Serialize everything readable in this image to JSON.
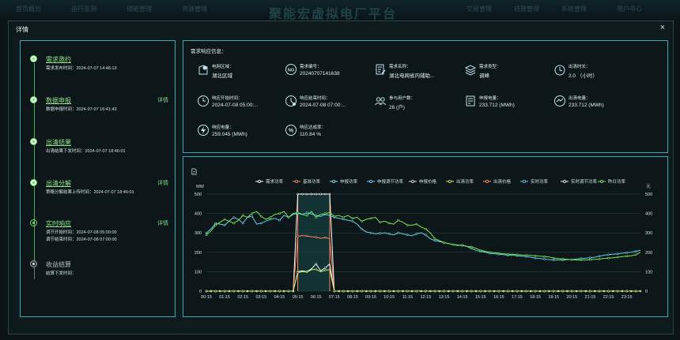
{
  "background": {
    "title": "聚能宏虚拟电厂平台",
    "nav_left": [
      "首页概览",
      "运行监测",
      "储能管理",
      "资源管理"
    ],
    "nav_right": [
      "交易管理",
      "结算管理",
      "系统管理",
      "用户中心"
    ]
  },
  "modal": {
    "title": "详情",
    "close_label": "×"
  },
  "timeline": [
    {
      "title": "需求邀约",
      "lines": [
        "需求发布时间：2024-07-07 14:46:13"
      ],
      "link": "",
      "state": "done"
    },
    {
      "title": "数据申报",
      "lines": [
        "数据申报时间：2024-07-07 16:41:43"
      ],
      "link": "详情",
      "state": "done"
    },
    {
      "title": "出清结果",
      "lines": [
        "出清结果下发时间：2024-07-07 18:46:01"
      ],
      "link": "",
      "state": "done"
    },
    {
      "title": "出清分解",
      "lines": [
        "策略分解结果上传时间：2024-07-07 18:46:01"
      ],
      "link": "详情",
      "state": "done"
    },
    {
      "title": "实时响应",
      "lines": [
        "调节开始时间：2024-07-08 05:00:00",
        "调节结束时间：2024-07-08 07:00:00"
      ],
      "link": "详情",
      "state": "active"
    },
    {
      "title": "收益结算",
      "lines": [
        "结算下发时间："
      ],
      "link": "",
      "state": "pending"
    }
  ],
  "info": {
    "header": "需求响应信息：",
    "items": [
      {
        "icon": "map-pin-icon",
        "label": "电网区域：",
        "value": "湖北区域"
      },
      {
        "icon": "no-badge-icon",
        "label": "需求编号：",
        "value": "20240707141638"
      },
      {
        "icon": "edit-doc-icon",
        "label": "需求名称：",
        "value": "湖北电网省内辅助..."
      },
      {
        "icon": "layers-icon",
        "label": "需求类型：",
        "value": "调峰"
      },
      {
        "icon": "timer-icon",
        "label": "出清时长：",
        "value": "2.0 （小时）"
      },
      {
        "icon": "clock-icon",
        "label": "响应开始时间：",
        "value": "2024-07-08 05:00:..."
      },
      {
        "icon": "clock-end-icon",
        "label": "响应结束时间：",
        "value": "2024-07-08 07:00:..."
      },
      {
        "icon": "users-icon",
        "label": "参与用户数：",
        "value": "26 (户)"
      },
      {
        "icon": "report-doc-icon",
        "label": "申报电量：",
        "value": "233.712 (MWh)"
      },
      {
        "icon": "gauge-icon",
        "label": "出清电量：",
        "value": "233.712 (MWh)"
      },
      {
        "icon": "bolt-icon",
        "label": "响应电量：",
        "value": "259.045 (MWh)"
      },
      {
        "icon": "percent-icon",
        "label": "响应达成率：",
        "value": "110.84 %"
      }
    ]
  },
  "chart_data": {
    "type": "line",
    "ylabel_left": "MW",
    "ylabel_right": "元",
    "ylim": [
      0,
      500
    ],
    "yticks": [
      0,
      100,
      200,
      300,
      400,
      500
    ],
    "xticks": [
      "00:15",
      "01:15",
      "02:15",
      "03:15",
      "04:15",
      "05:15",
      "06:15",
      "07:15",
      "08:15",
      "09:15",
      "10:15",
      "11:15",
      "12:15",
      "13:15",
      "14:15",
      "15:15",
      "16:15",
      "17:15",
      "18:15",
      "19:15",
      "20:15",
      "21:15",
      "22:15",
      "23:15"
    ],
    "legend": [
      {
        "name": "需求功率",
        "color": "#ffffff"
      },
      {
        "name": "基准功率",
        "color": "#ff8a65"
      },
      {
        "name": "申报功率",
        "color": "#9be3ef"
      },
      {
        "name": "申报调节功率",
        "color": "#82d2ff"
      },
      {
        "name": "申报价格",
        "color": "#dddddd"
      },
      {
        "name": "出清功率",
        "color": "#c8f06a"
      },
      {
        "name": "出清价格",
        "color": "#ff9b52"
      },
      {
        "name": "实时功率",
        "color": "#5fd3e8"
      },
      {
        "name": "实时调节功率",
        "color": "#e8f7ff"
      },
      {
        "name": "昨日功率",
        "color": "#7ce85a"
      }
    ],
    "series": [
      {
        "name": "需求功率",
        "color": "#ffffff",
        "values": [
          0,
          0,
          0,
          0,
          0,
          0,
          0,
          0,
          0,
          0,
          0,
          0,
          0,
          0,
          0,
          0,
          0,
          0,
          0,
          0,
          500,
          500,
          500,
          500,
          500,
          500,
          500,
          500,
          0,
          0,
          0,
          0,
          0,
          0,
          0,
          0,
          0,
          0,
          0,
          0,
          0,
          0,
          0,
          0,
          0,
          0,
          0,
          0,
          0,
          0,
          0,
          0,
          0,
          0,
          0,
          0,
          0,
          0,
          0,
          0,
          0,
          0,
          0,
          0,
          0,
          0,
          0,
          0,
          0,
          0,
          0,
          0,
          0,
          0,
          0,
          0,
          0,
          0,
          0,
          0,
          0,
          0,
          0,
          0,
          0,
          0,
          0,
          0,
          0,
          0,
          0,
          0,
          0,
          0,
          0,
          0
        ]
      },
      {
        "name": "基准功率",
        "color": "#ff8a65",
        "values": [
          0,
          0,
          0,
          0,
          0,
          0,
          0,
          0,
          0,
          0,
          0,
          0,
          0,
          0,
          0,
          0,
          0,
          0,
          0,
          0,
          282,
          286,
          284,
          280,
          278,
          272,
          276,
          270,
          0,
          0,
          0,
          0,
          0,
          0,
          0,
          0,
          0,
          0,
          0,
          0,
          0,
          0,
          0,
          0,
          0,
          0,
          0,
          0,
          0,
          0,
          0,
          0,
          0,
          0,
          0,
          0,
          0,
          0,
          0,
          0,
          0,
          0,
          0,
          0,
          0,
          0,
          0,
          0,
          0,
          0,
          0,
          0,
          0,
          0,
          0,
          0,
          0,
          0,
          0,
          0,
          0,
          0,
          0,
          0,
          0,
          0,
          0,
          0,
          0,
          0,
          0,
          0,
          0,
          0,
          0,
          0
        ]
      },
      {
        "name": "实时调节功率",
        "color": "#e8f7ff",
        "values": [
          0,
          0,
          0,
          0,
          0,
          0,
          0,
          0,
          0,
          0,
          0,
          0,
          0,
          0,
          0,
          0,
          0,
          0,
          0,
          0,
          100,
          105,
          100,
          115,
          140,
          105,
          120,
          140,
          0,
          0,
          0,
          0,
          0,
          0,
          0,
          0,
          0,
          0,
          0,
          0,
          0,
          0,
          0,
          0,
          0,
          0,
          0,
          0,
          0,
          0,
          0,
          0,
          0,
          0,
          0,
          0,
          0,
          0,
          0,
          0,
          0,
          0,
          0,
          0,
          0,
          0,
          0,
          0,
          0,
          0,
          0,
          0,
          0,
          0,
          0,
          0,
          0,
          0,
          0,
          0,
          0,
          0,
          0,
          0,
          0,
          0,
          0,
          0,
          0,
          0,
          0,
          0,
          0,
          0,
          0,
          0
        ]
      },
      {
        "name": "出清功率",
        "color": "#c8f06a",
        "values": [
          0,
          0,
          0,
          0,
          0,
          0,
          0,
          0,
          0,
          0,
          0,
          0,
          0,
          0,
          0,
          0,
          0,
          0,
          0,
          0,
          95,
          100,
          98,
          110,
          112,
          100,
          108,
          110,
          0,
          0,
          0,
          0,
          0,
          0,
          0,
          0,
          0,
          0,
          0,
          0,
          0,
          0,
          0,
          0,
          0,
          0,
          0,
          0,
          0,
          0,
          0,
          0,
          0,
          0,
          0,
          0,
          0,
          0,
          0,
          0,
          0,
          0,
          0,
          0,
          0,
          0,
          0,
          0,
          0,
          0,
          0,
          0,
          0,
          0,
          0,
          0,
          0,
          0,
          0,
          0,
          0,
          0,
          0,
          0,
          0,
          0,
          0,
          0,
          0,
          0,
          0,
          0,
          0,
          0,
          0,
          0
        ]
      },
      {
        "name": "实时功率",
        "color": "#5fd3e8",
        "values": [
          300,
          320,
          350,
          345,
          340,
          360,
          380,
          370,
          350,
          380,
          385,
          345,
          350,
          360,
          370,
          375,
          365,
          390,
          380,
          395,
          400,
          395,
          405,
          398,
          390,
          385,
          395,
          390,
          380,
          375,
          370,
          365,
          360,
          345,
          320,
          305,
          300,
          295,
          298,
          300,
          295,
          290,
          300,
          295,
          290,
          285,
          295,
          300,
          290,
          270,
          260,
          255,
          250,
          245,
          240,
          238,
          235,
          230,
          220,
          210,
          205,
          200,
          195,
          192,
          190,
          188,
          185,
          186,
          182,
          180,
          178,
          175,
          170,
          168,
          165,
          162,
          160,
          160,
          160,
          162,
          162,
          165,
          168,
          170,
          172,
          175,
          180,
          185,
          188,
          190,
          192,
          195,
          198,
          200,
          205,
          210
        ]
      },
      {
        "name": "昨日功率",
        "color": "#7ce85a",
        "values": [
          290,
          310,
          340,
          355,
          370,
          360,
          350,
          365,
          390,
          380,
          400,
          410,
          385,
          370,
          380,
          395,
          400,
          410,
          380,
          400,
          405,
          395,
          390,
          410,
          380,
          395,
          400,
          405,
          385,
          390,
          380,
          390,
          375,
          380,
          360,
          370,
          375,
          380,
          355,
          360,
          350,
          345,
          365,
          355,
          340,
          340,
          345,
          330,
          320,
          300,
          270,
          260,
          250,
          245,
          240,
          235,
          238,
          230,
          228,
          220,
          210,
          205,
          200,
          198,
          195,
          192,
          190,
          190,
          188,
          186,
          185,
          184,
          182,
          180,
          178,
          176,
          170,
          168,
          166,
          164,
          162,
          160,
          160,
          160,
          162,
          164,
          165,
          168,
          170,
          172,
          175,
          178,
          180,
          182,
          188,
          200
        ]
      }
    ]
  }
}
